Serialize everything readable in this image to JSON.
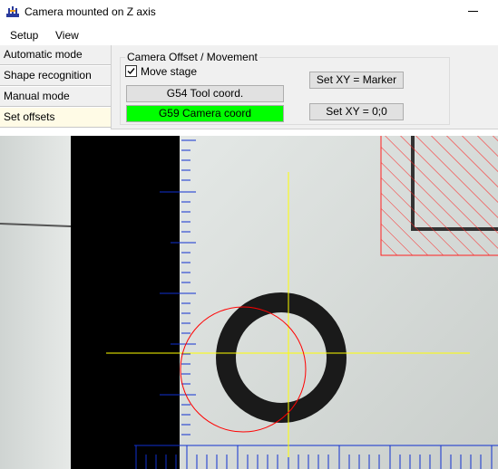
{
  "window": {
    "title": "Camera mounted on Z axis"
  },
  "menu": {
    "items": [
      "Setup",
      "View"
    ]
  },
  "modes": {
    "tabs": [
      {
        "label": "Automatic mode"
      },
      {
        "label": "Shape recognition"
      },
      {
        "label": "Manual mode"
      },
      {
        "label": "Set offsets"
      }
    ],
    "active_index": 3
  },
  "offsets_panel": {
    "group_title": "Camera Offset / Movement",
    "move_stage_label": "Move stage",
    "move_stage_checked": true,
    "g54_label": "G54 Tool coord.",
    "g59_label": "G59 Camera coord",
    "g59_active_color": "#00ff00",
    "set_xy_marker_label": "Set XY = Marker",
    "set_xy_zero_label": "Set XY = 0;0"
  },
  "camera_view": {
    "crosshair_color": "#ffff00",
    "marker_circle_color": "#ff0000",
    "ruler_color": "#0000cc",
    "hatched_zone_color": "#ff0000"
  }
}
